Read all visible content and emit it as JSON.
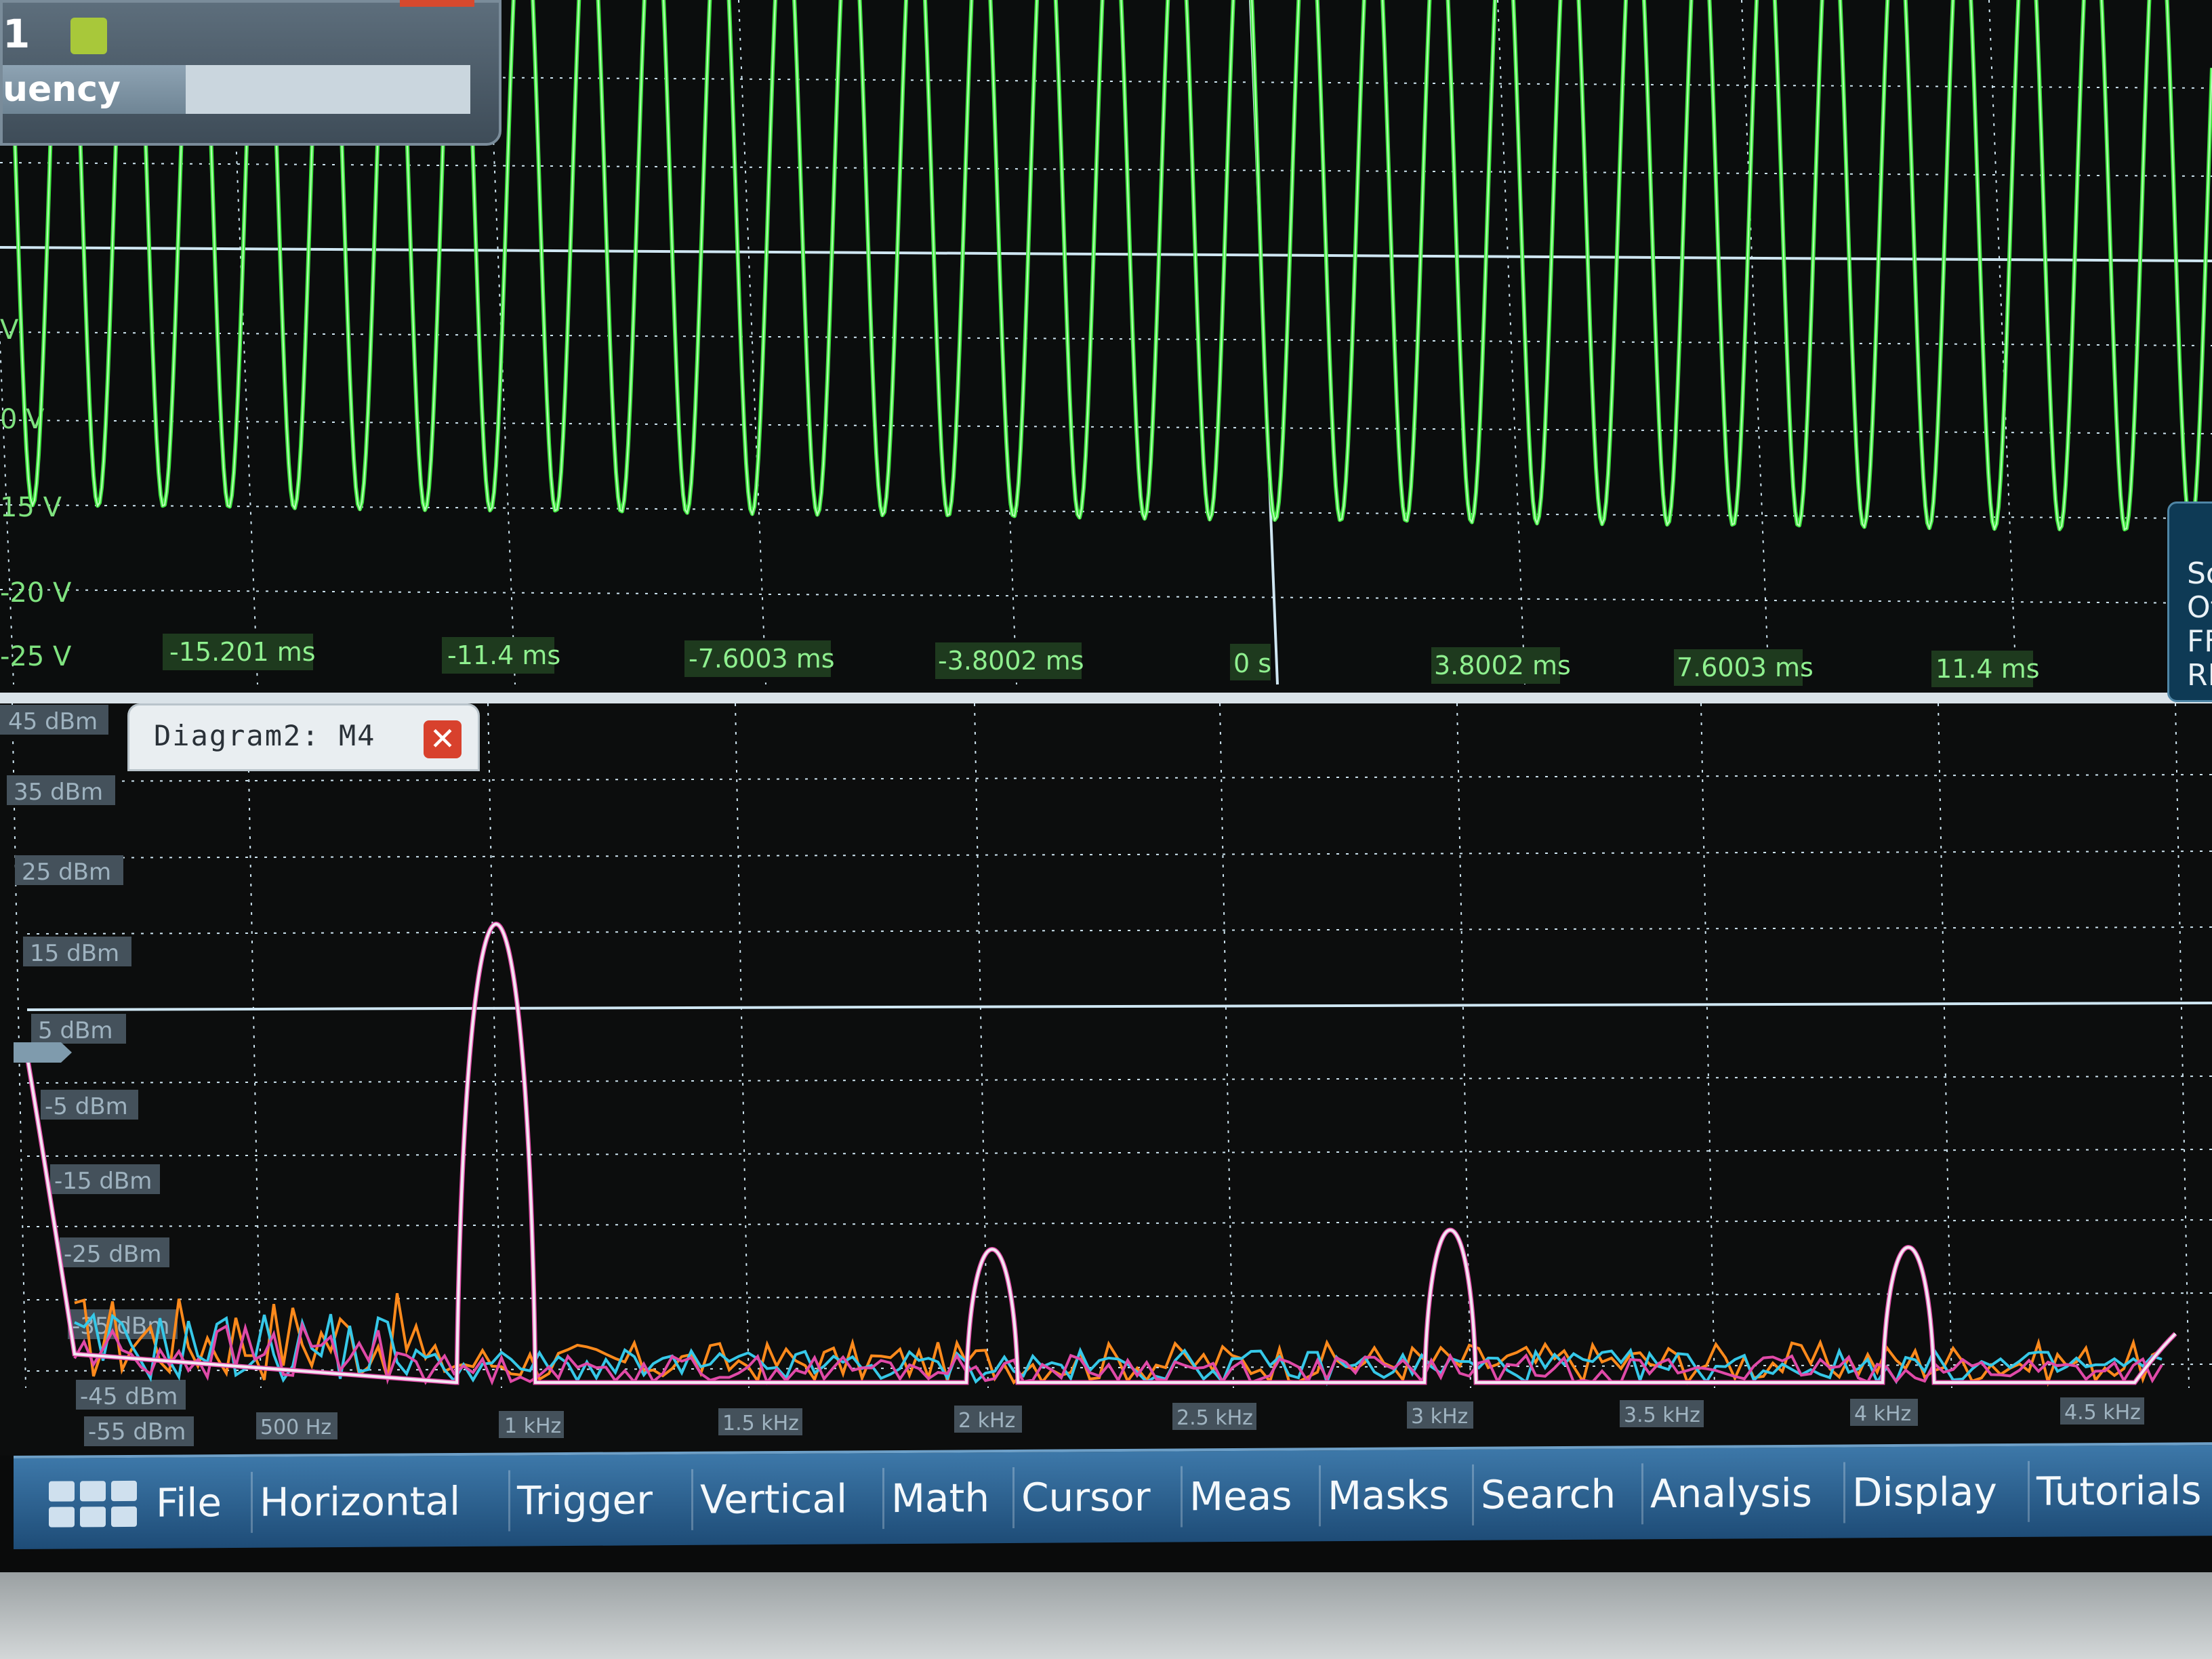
{
  "waveform_panel": {
    "channel_number": "1",
    "measurement_label": "uency",
    "y_labels": [
      "V",
      "0 V",
      "15 V",
      "-20 V",
      "-25 V"
    ],
    "time_labels": [
      "-15.201 ms",
      "-11.4 ms",
      "-7.6003 ms",
      "-3.8002 ms",
      "0 s",
      "3.8002 ms",
      "7.6003 ms",
      "11.4 ms"
    ]
  },
  "fft_panel": {
    "tab_title": "Diagram2: M4",
    "db_labels": [
      "45 dBm",
      "35 dBm",
      "25 dBm",
      "15 dBm",
      "5 dBm",
      "-5 dBm",
      "-15 dBm",
      "-25 dBm",
      "-35 dBm",
      "-45 dBm",
      "-55 dBm"
    ],
    "freq_labels": [
      "500 Hz",
      "1 kHz",
      "1.5 kHz",
      "2 kHz",
      "2.5 kHz",
      "3 kHz",
      "3.5 kHz",
      "4 kHz",
      "4.5 kHz"
    ]
  },
  "side_panel": {
    "lines": [
      "Sc",
      "Of",
      "FF",
      "RB"
    ]
  },
  "menu": {
    "items": [
      "File",
      "Horizontal",
      "Trigger",
      "Vertical",
      "Math",
      "Cursor",
      "Meas",
      "Masks",
      "Search",
      "Analysis",
      "Display",
      "Tutorials"
    ]
  },
  "colors": {
    "waveform": "#3ee63e",
    "fft_main": "#f2e8f2",
    "fft_pink": "#e04aa8",
    "fft_orange": "#ff8a1c",
    "fft_cyan": "#36c8e8",
    "grid": "#cfe6f2",
    "label_bg": "#44515b",
    "menu_bg": "#2a5f8f"
  }
}
